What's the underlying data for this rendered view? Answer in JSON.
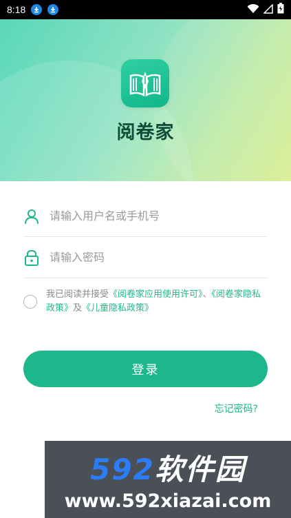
{
  "status_bar": {
    "time": "8:18",
    "icons": [
      "download-icon",
      "download-icon",
      "wifi-icon",
      "signal-icon",
      "battery-icon"
    ]
  },
  "header": {
    "app_name": "阅卷家",
    "logo_icon": "book-pen-icon",
    "colors": {
      "gradient_start": "#5ad7b9",
      "gradient_end": "#d8ee8e",
      "logo_bg": "#1cb88c"
    }
  },
  "form": {
    "username": {
      "placeholder": "请输入用户名或手机号",
      "value": "",
      "icon": "user-icon"
    },
    "password": {
      "placeholder": "请输入密码",
      "value": "",
      "icon": "lock-icon"
    },
    "agreement": {
      "checked": false,
      "prefix": "我已阅读并接受",
      "link1": "《阅卷家应用使用许可》",
      "separator": "、",
      "link2": "《阅卷家隐私政策》",
      "conjunction": "及",
      "link3": "《儿童隐私政策》"
    },
    "login_label": "登录",
    "forgot_label": "忘记密码?"
  },
  "watermark": {
    "number": "592",
    "name": "软件园",
    "url": "www.592xiazai.com"
  },
  "colors": {
    "accent": "#1cb88c",
    "link": "#20b88c"
  }
}
